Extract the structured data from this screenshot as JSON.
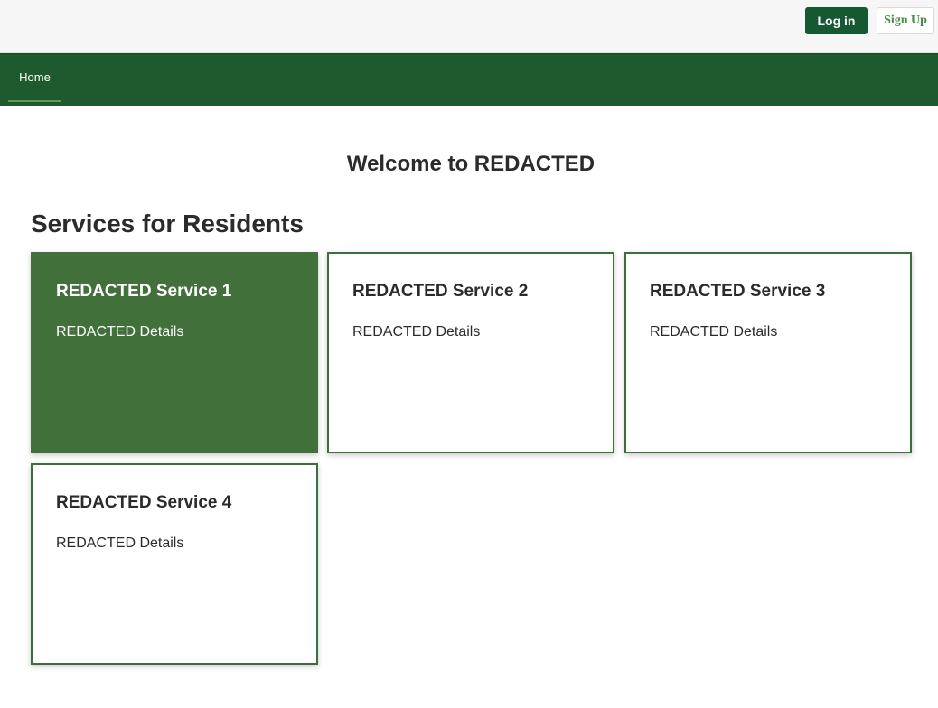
{
  "header": {
    "login_label": "Log in",
    "signup_label": "Sign Up"
  },
  "nav": {
    "items": [
      {
        "label": "Home"
      }
    ]
  },
  "main": {
    "welcome": "Welcome to REDACTED",
    "section_title": "Services for Residents",
    "services": [
      {
        "title": "REDACTED Service 1",
        "details": "REDACTED Details",
        "active": true
      },
      {
        "title": "REDACTED Service 2",
        "details": "REDACTED Details",
        "active": false
      },
      {
        "title": "REDACTED Service 3",
        "details": "REDACTED Details",
        "active": false
      },
      {
        "title": "REDACTED Service 4",
        "details": "REDACTED Details",
        "active": false
      }
    ]
  },
  "colors": {
    "brand_dark": "#165832",
    "navbar": "#1f5a2e",
    "card_active": "#42703b",
    "card_border": "#3e6e3c",
    "signup_text": "#4b8a46"
  }
}
